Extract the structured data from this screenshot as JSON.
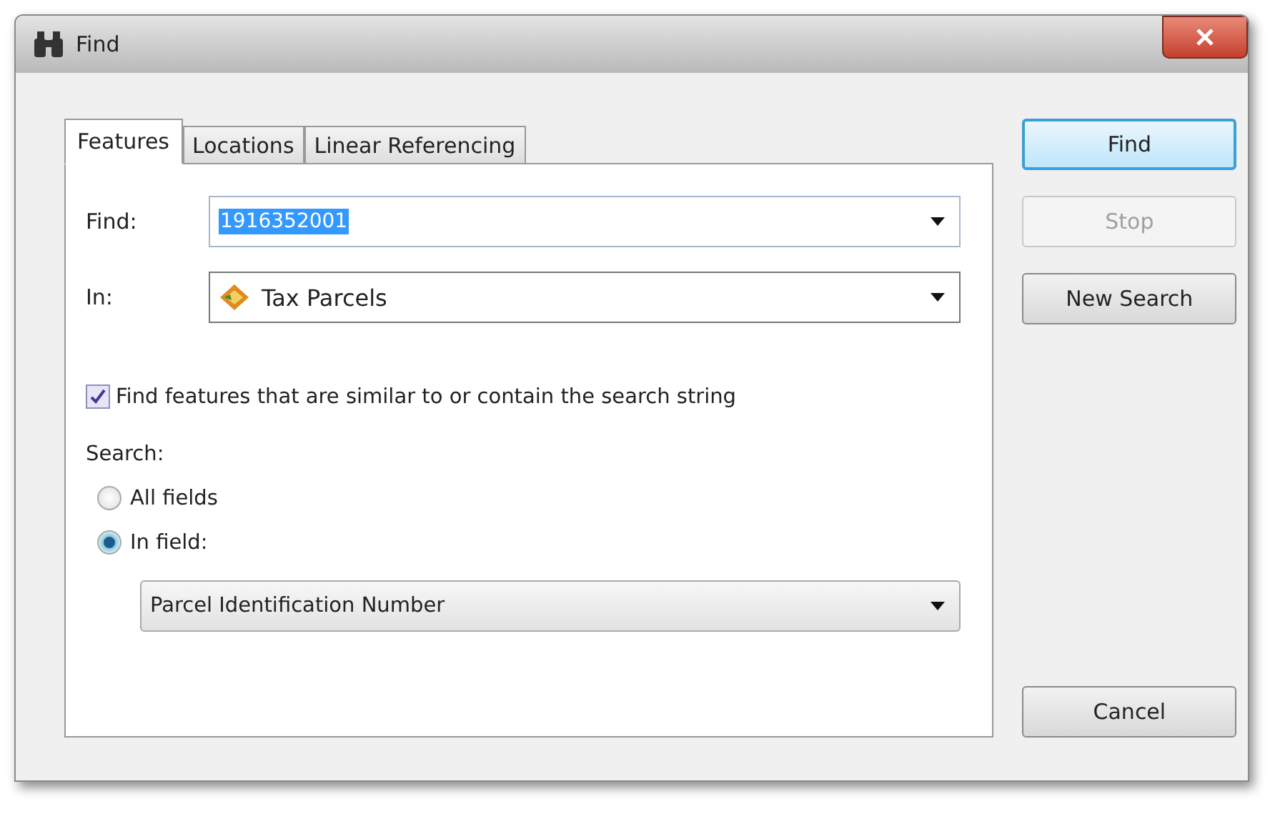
{
  "window": {
    "title": "Find"
  },
  "tabs": [
    {
      "label": "Features",
      "selected": true
    },
    {
      "label": "Locations",
      "selected": false
    },
    {
      "label": "Linear Referencing",
      "selected": false
    }
  ],
  "find_field": {
    "label": "Find:",
    "value": "1916352001",
    "highlighted": true
  },
  "in_field": {
    "label": "In:",
    "value": "Tax Parcels"
  },
  "similar_checkbox": {
    "label": "Find features that are similar to or contain the search string",
    "checked": true
  },
  "search": {
    "label": "Search:",
    "options": [
      {
        "label": "All fields",
        "selected": false
      },
      {
        "label": "In field:",
        "selected": true
      }
    ]
  },
  "field_select": {
    "value": "Parcel Identification Number"
  },
  "buttons": [
    {
      "label": "Find",
      "kind": "default"
    },
    {
      "label": "Stop",
      "kind": "disabled"
    },
    {
      "label": "New Search",
      "kind": "normal"
    }
  ],
  "cancel_button": {
    "label": "Cancel"
  }
}
